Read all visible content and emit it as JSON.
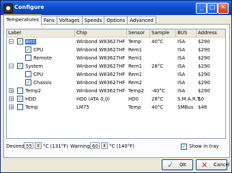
{
  "window": {
    "title": "Configure"
  },
  "tabs": [
    "Temperatures",
    "Fans",
    "Voltages",
    "Speeds",
    "Options",
    "Advanced"
  ],
  "columns": [
    "Label",
    "Chip",
    "Sensor",
    "Sample",
    "BUS",
    "Address"
  ],
  "rows": [
    {
      "label": "Bit0",
      "chip": "Winbond W83627HF",
      "sensor": "Temp",
      "sample": "40°C",
      "bus": "ISA",
      "address": "$290"
    },
    {
      "label": "CPU",
      "chip": "Winbond W83627HF",
      "sensor": "Rem1",
      "sample": "",
      "bus": "ISA",
      "address": "$290"
    },
    {
      "label": "Remote",
      "chip": "Winbond W83627HF",
      "sensor": "Rem1",
      "sample": "",
      "bus": "ISA",
      "address": "$290"
    },
    {
      "label": "System",
      "chip": "Winbond W83627HF",
      "sensor": "Rem1",
      "sample": "28°C",
      "bus": "ISA",
      "address": "$290"
    },
    {
      "label": "CPU",
      "chip": "Winbond W83627HF",
      "sensor": "Rem1",
      "sample": "",
      "bus": "ISA",
      "address": "$290"
    },
    {
      "label": "Chassis",
      "chip": "Winbond W83627HF",
      "sensor": "Rem2",
      "sample": "",
      "bus": "ISA",
      "address": "$290"
    },
    {
      "label": "Temp2",
      "chip": "Winbond W83627HF",
      "sensor": "Temp2",
      "sample": "-40°C",
      "bus": "ISA",
      "address": "$290"
    },
    {
      "label": "HDD",
      "chip": "HD0 (ATA 0,0)",
      "sensor": "HD0",
      "sample": "28°C",
      "bus": "S.M.A.R.T.",
      "address": "$0"
    },
    {
      "label": "Temp",
      "chip": "LM75",
      "sensor": "Temp",
      "sample": "40°C",
      "bus": "SMBus",
      "address": "$48"
    }
  ],
  "bottom": {
    "desired_label": "Desired",
    "desired_value": "55",
    "desired_unit": "°C (131°F)",
    "warning_label": "Warning",
    "warning_value": "60",
    "warning_unit": "°C (140°F)",
    "show_in_tray_label": "Show in tray"
  },
  "buttons": {
    "ok": "OK",
    "cancel": "Cancel"
  }
}
